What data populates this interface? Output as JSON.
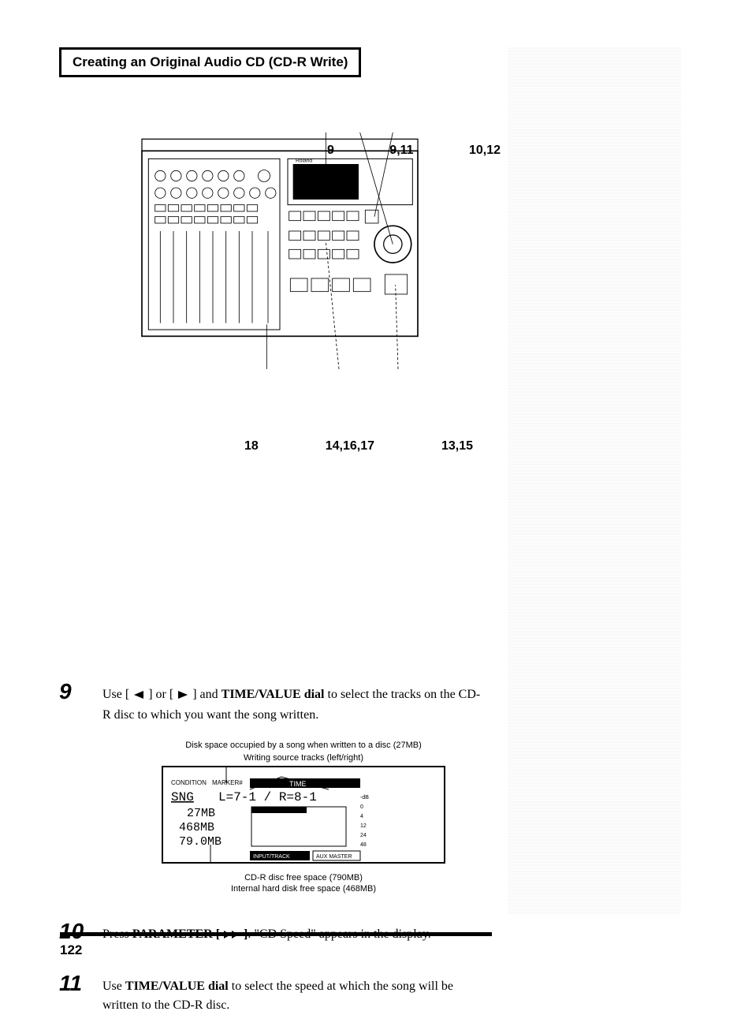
{
  "header": "Creating an Original Audio CD (CD-R Write)",
  "callouts": {
    "top": [
      "9",
      "9,11",
      "10,12"
    ],
    "bottom": [
      "18",
      "14,16,17",
      "13,15"
    ]
  },
  "device_brand": "Roland",
  "lcd": {
    "caption_top1": "Disk space occupied by a song when written to a disc (27MB)",
    "caption_top2": "Writing source tracks (left/right)",
    "row_condition": "CONDITION",
    "row_marker": "MARKER#",
    "tab_time": "TIME",
    "sng": "SNG",
    "lr": "L=7-1 / R=8-1",
    "mb1": "27MB",
    "mb2": "468MB",
    "mb3": "79.0MB",
    "scale": [
      "-dB",
      "0",
      "4",
      "12",
      "24",
      "48"
    ],
    "footer_left": "INPUT/TRACK",
    "footer_right": "AUX MASTER",
    "caption_bot1": "CD-R disc free space (790MB)",
    "caption_bot2": "Internal hard disk free space (468MB)"
  },
  "steps": {
    "s9": {
      "num": "9",
      "pre": "Use [",
      "mid": "] or [",
      "post": "] and ",
      "bold1": "TIME/VALUE dial",
      "tail": " to select the tracks on the CD-R disc to which you want the song written."
    },
    "s10": {
      "num": "10",
      "pre": "Press ",
      "bold1": "PARAMETER [",
      "post_bold": " ]",
      "tail": ". \"CD Speed\" appears in the display."
    },
    "s11": {
      "num": "11",
      "pre": "Use ",
      "bold1": "TIME/VALUE dial",
      "tail": " to select the speed at which the song will be written to the CD-R disc."
    }
  },
  "page_number": "122"
}
